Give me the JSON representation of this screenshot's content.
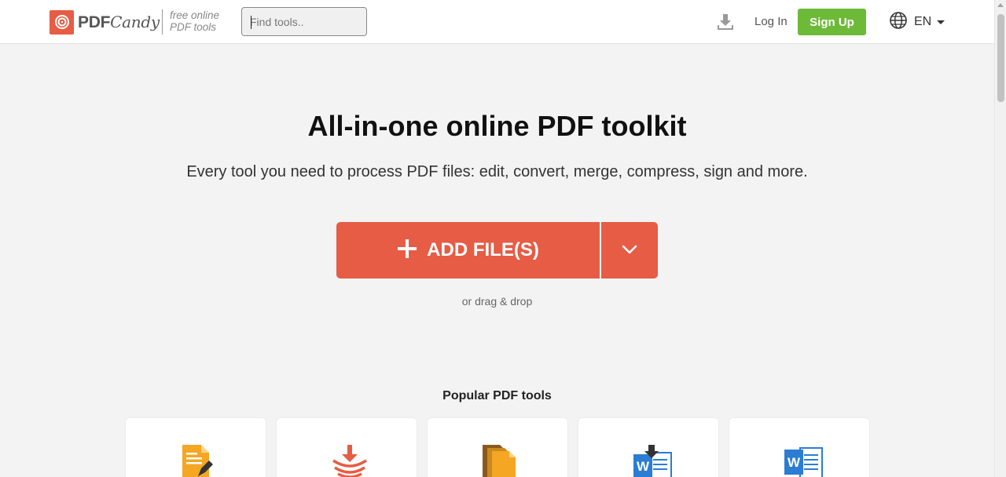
{
  "header": {
    "logo_text": "PDF",
    "logo_text_accent": "Candy",
    "tagline_line1": "free online",
    "tagline_line2": "PDF tools",
    "search_placeholder": "Find tools..",
    "download_icon": "download-icon",
    "login_label": "Log In",
    "signup_label": "Sign Up",
    "language_icon": "globe-icon",
    "language_code": "EN"
  },
  "hero": {
    "title": "All-in-one online PDF toolkit",
    "subtitle": "Every tool you need to process PDF files: edit, convert, merge, compress, sign and more.",
    "add_button_label": "ADD FILE(S)",
    "add_button_icon": "plus-icon",
    "dropdown_icon": "chevron-down-icon",
    "drag_text": "or drag & drop"
  },
  "popular": {
    "title": "Popular PDF tools",
    "tools": [
      {
        "icon": "edit-pdf-icon"
      },
      {
        "icon": "compress-pdf-icon"
      },
      {
        "icon": "merge-pdf-icon"
      },
      {
        "icon": "word-to-pdf-icon"
      },
      {
        "icon": "pdf-to-word-icon"
      }
    ]
  },
  "colors": {
    "accent": "#e65c45",
    "signup": "#6cba38",
    "background": "#f3f3f3"
  }
}
